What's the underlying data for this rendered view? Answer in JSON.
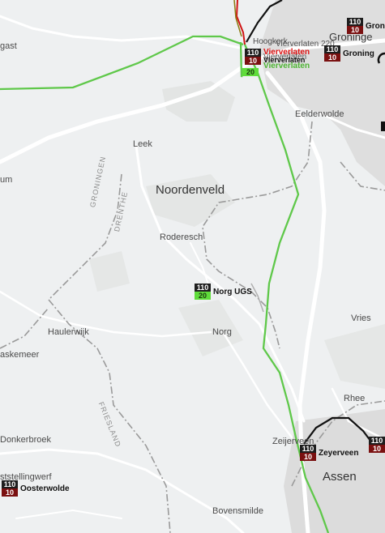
{
  "places": {
    "gast": "gast",
    "groningen_top": "Groninge",
    "groningen_right": "Groningen",
    "hoogkerk": "Hoogkerk",
    "vierverlaten_grey_top": "Vierverlaten 220",
    "vierverlaten_grey": "Vierverlaten",
    "eelderwolde": "Eelderwolde",
    "leek": "Leek",
    "um": "um",
    "noordenveld": "Noordenveld",
    "roderesch": "Roderesch",
    "norg": "Norg",
    "vries": "Vries",
    "haulerwijk": "Haulerwijk",
    "askemeer": "askemeer",
    "rhee": "Rhee",
    "donkerbroek": "Donkerbroek",
    "zeijerveen": "Zeijerveen",
    "assen": "Assen",
    "ststellingwerf": "ststellingwerf",
    "bovensmilde": "Bovensmilde"
  },
  "province_labels": {
    "groningen": "GRONINGEN",
    "drenthe": "DRENTHE",
    "friesland": "FRIESLAND"
  },
  "stations": {
    "gron_top": {
      "top": "110",
      "bottom": "10",
      "label": "Gron"
    },
    "groningen": {
      "top": "110",
      "bottom": "10",
      "label": "Groning"
    },
    "vierverlaten_red": {
      "top": "110",
      "bottom": "10",
      "label": "Vierverlaten"
    },
    "vierverlaten_black": {
      "top": "110",
      "bottom": "10",
      "label": "Vierverlaten"
    },
    "vierverlaten_green": {
      "top": "",
      "bottom": "20",
      "label": "Vierverlaten"
    },
    "norg_ugs": {
      "top": "110",
      "bottom": "20",
      "label": "Norg UGS"
    },
    "zeyerveen": {
      "top": "110",
      "bottom": "10",
      "label": "Zeyerveen"
    },
    "zeyerveen_right": {
      "top": "110",
      "bottom": "10",
      "label": ""
    },
    "oosterwolde": {
      "top": "110",
      "bottom": "10",
      "label": "Oosterwolde"
    }
  },
  "colors": {
    "background": "#eef0f1",
    "road": "#ffffff",
    "urban": "#dcdcdc",
    "forest": "#e2e4e3",
    "boundary": "#9a9a9a",
    "line_green": "#5fc84a",
    "line_red": "#d01414",
    "line_black": "#111111",
    "badge_top": "#1e1e1e",
    "badge_red": "#7a1010",
    "badge_green": "#5fdc3a"
  }
}
